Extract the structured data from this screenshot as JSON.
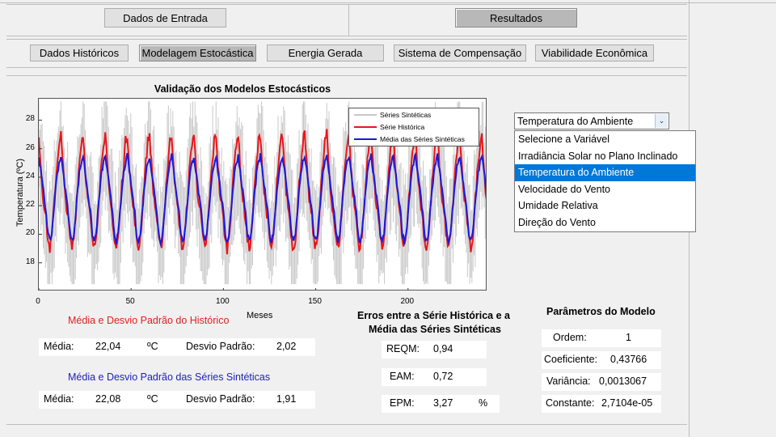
{
  "tabs": {
    "input": "Dados de Entrada",
    "results": "Resultados"
  },
  "subtabs": [
    "Dados Históricos",
    "Modelagem Estocástica",
    "Energia Gerada",
    "Sistema de Compensação",
    "Viabilidade Econômica"
  ],
  "variable_select": {
    "value": "Temperatura do Ambiente",
    "options": [
      "Selecione a Variável",
      "Irradiância Solar no Plano Inclinado",
      "Temperatura do Ambiente",
      "Velocidade do Vento",
      "Umidade Relativa",
      "Direção do Vento"
    ],
    "selected_index": 2
  },
  "chart_data": {
    "type": "line",
    "title": "Validação dos Modelos Estocásticos",
    "xlabel": "Meses",
    "ylabel": "Temperatura (ºC)",
    "xlim": [
      0,
      243
    ],
    "ylim": [
      16,
      29.5
    ],
    "x_ticks": [
      0,
      50,
      100,
      150,
      200
    ],
    "y_ticks": [
      18,
      20,
      22,
      24,
      26,
      28
    ],
    "legend": {
      "position": "top-right",
      "entries": [
        "Séries Sintéticas",
        "Série Histórica",
        "Média das Séries Sintéticas"
      ]
    },
    "colors": {
      "synthetic": "#c8c8c8",
      "historical": "#e8161b",
      "mean": "#1a1adb"
    },
    "period_months": 12,
    "series": [
      {
        "name": "Série Histórica",
        "seasonal_profile": [
          27.0,
          25.0,
          23.0,
          22.0,
          21.0,
          19.5,
          19.0,
          19.8,
          21.5,
          23.5,
          25.0,
          26.5
        ]
      },
      {
        "name": "Média das Séries Sintéticas",
        "seasonal_profile": [
          25.5,
          24.5,
          23.5,
          22.5,
          21.5,
          20.0,
          19.5,
          20.0,
          21.5,
          23.0,
          24.3,
          25.0
        ]
      },
      {
        "name": "Séries Sintéticas",
        "range": [
          16.5,
          29.3
        ]
      }
    ]
  },
  "historical_stats": {
    "title": "Média e Desvio Padrão do Histórico",
    "mean_label": "Média:",
    "mean": "22,04",
    "unit": "ºC",
    "std_label": "Desvio Padrão:",
    "std": "2,02"
  },
  "synthetic_stats": {
    "title": "Média e Desvio Padrão das Séries Sintéticas",
    "mean_label": "Média:",
    "mean": "22,08",
    "unit": "ºC",
    "std_label": "Desvio Padrão:",
    "std": "1,91"
  },
  "errors": {
    "title_line1": "Erros entre a Série Histórica e a",
    "title_line2": "Média das Séries Sintéticas",
    "reqm_label": "REQM:",
    "reqm": "0,94",
    "eam_label": "EAM:",
    "eam": "0,72",
    "epm_label": "EPM:",
    "epm": "3,27",
    "epm_unit": "%"
  },
  "model_params": {
    "title": "Parâmetros do Modelo",
    "order_label": "Ordem:",
    "order": "1",
    "coef_label": "Coeficiente:",
    "coef": "0,43766",
    "var_label": "Variância:",
    "var": "0,0013067",
    "const_label": "Constante:",
    "const": "2,7104e-05"
  }
}
